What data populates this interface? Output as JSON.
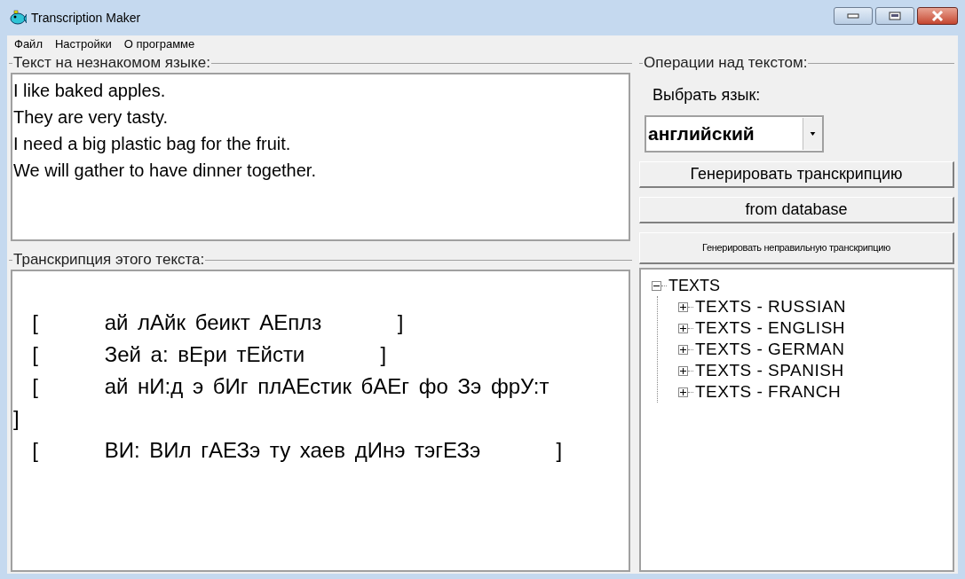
{
  "window": {
    "title": "Transcription Maker"
  },
  "menu": [
    "Файл",
    "Настройки",
    "О программе"
  ],
  "source_panel": {
    "legend": "Текст на незнакомом языке:",
    "lines": [
      "I like baked apples.",
      "They are very tasty.",
      "I need a big plastic bag for the fruit.",
      "We will gather to have dinner together."
    ]
  },
  "transcription_panel": {
    "legend": "Транскрипция этого текста:",
    "lines": [
      "  [       ай лАйк беикт АЕплз        ]",
      "  [       Зей а: вЕри тЕйсти        ]",
      "  [       ай нИ:д э бИг плАЕстик бАЕг фо Зэ фрУ:т       ]",
      "  [       ВИ: ВИл гАЕЗэ ту хаев дИнэ тэгЕЗэ        ]"
    ]
  },
  "operations_panel": {
    "legend": "Операции над текстом:",
    "language_label": "Выбрать язык:",
    "language_value": "английский",
    "buttons": [
      {
        "label": "Генерировать транскрипцию",
        "kind": "large"
      },
      {
        "label": "from database",
        "kind": "large"
      },
      {
        "label": "Генерировать неправильную транскрипцию",
        "kind": "small"
      }
    ]
  },
  "tree": [
    {
      "label": "TEXTS",
      "expanded": true,
      "children": [
        {
          "label": "TEXTS - RUSSIAN",
          "expanded": false
        },
        {
          "label": "TEXTS - ENGLISH",
          "expanded": false
        },
        {
          "label": "TEXTS - GERMAN",
          "expanded": false
        },
        {
          "label": "TEXTS - SPANISH",
          "expanded": false
        },
        {
          "label": "TEXTS - FRANCH",
          "expanded": false
        }
      ]
    }
  ]
}
